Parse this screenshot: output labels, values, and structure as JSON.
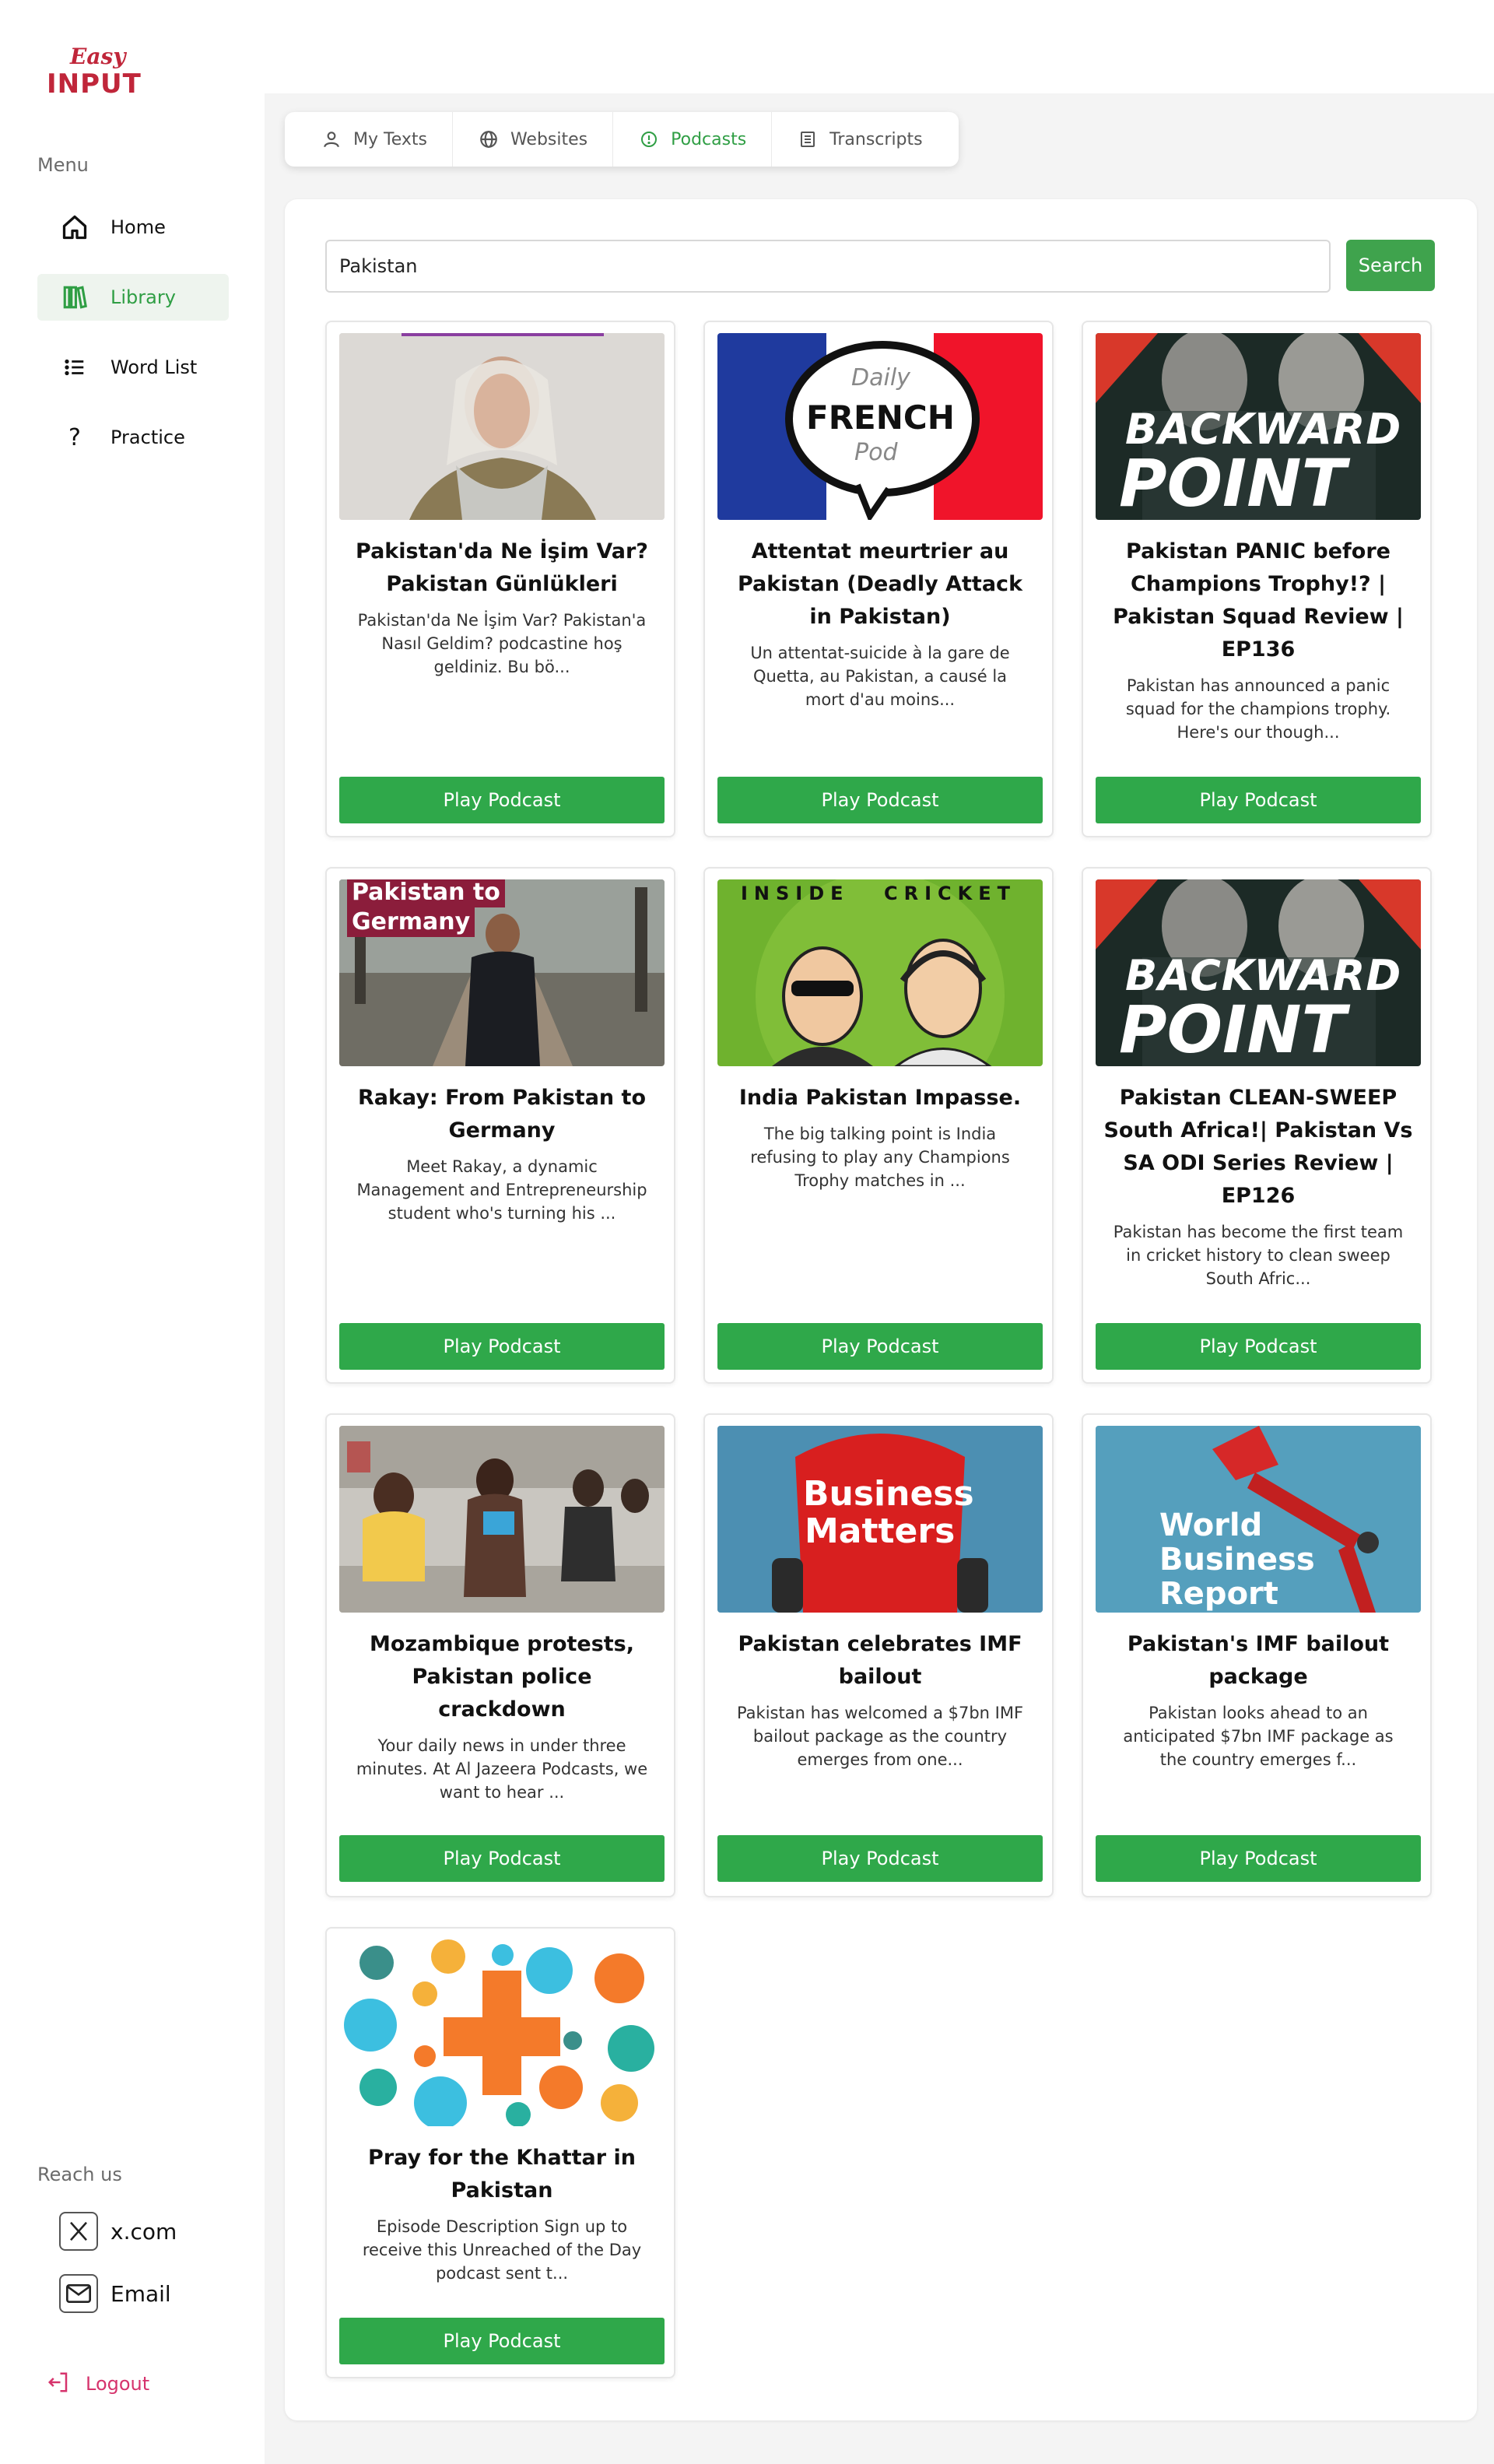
{
  "brand": {
    "logo_top": "Easy",
    "logo_bottom": "INPUT",
    "accent": "#c0263a",
    "green": "#2fa84a"
  },
  "sidebar": {
    "menu_label": "Menu",
    "items": [
      {
        "label": "Home",
        "icon": "home-icon"
      },
      {
        "label": "Library",
        "icon": "library-icon",
        "active": true
      },
      {
        "label": "Word List",
        "icon": "list-icon"
      },
      {
        "label": "Practice",
        "icon": "question-icon"
      }
    ],
    "reach_label": "Reach us",
    "contacts": [
      {
        "label": "x.com",
        "icon": "x-icon"
      },
      {
        "label": "Email",
        "icon": "mail-icon"
      }
    ],
    "logout_label": "Logout"
  },
  "tabs": [
    {
      "label": "My Texts",
      "icon": "user-icon"
    },
    {
      "label": "Websites",
      "icon": "globe-icon"
    },
    {
      "label": "Podcasts",
      "icon": "info-circle-icon",
      "active": true
    },
    {
      "label": "Transcripts",
      "icon": "document-icon"
    }
  ],
  "search": {
    "value": "Pakistan",
    "button_label": "Search"
  },
  "play_label": "Play Podcast",
  "podcasts": [
    {
      "title": "Pakistan'da Ne İşim Var? Pakistan Günlükleri",
      "desc": "Pakistan'da Ne İşim Var? Pakistan'a Nasıl Geldim? podcastine hoş geldiniz. Bu bö...",
      "thumb": "portrait"
    },
    {
      "title": "Attentat meurtrier au Pakistan (Deadly Attack in Pakistan)",
      "desc": "Un attentat-suicide à la gare de Quetta, au Pakistan, a causé la mort d'au moins...",
      "thumb": "french",
      "thumb_text": [
        "Daily",
        "FRENCH",
        "Pod"
      ]
    },
    {
      "title": "Pakistan PANIC before Champions Trophy!? | Pakistan Squad Review | EP136",
      "desc": "Pakistan has announced a panic squad for the champions trophy. Here's our though...",
      "thumb": "backward",
      "thumb_text": [
        "BACKWARD",
        "POINT"
      ]
    },
    {
      "title": "Rakay: From Pakistan to Germany",
      "desc": "Meet Rakay, a dynamic Management and Entrepreneurship student who's turning his ...",
      "thumb": "park",
      "thumb_text": [
        "Pakistan to",
        "Germany"
      ]
    },
    {
      "title": "India Pakistan Impasse.",
      "desc": "The big talking point is India refusing to play any Champions Trophy matches in ...",
      "thumb": "cricket",
      "thumb_text": [
        "INSIDE",
        "CRICKET"
      ]
    },
    {
      "title": "Pakistan CLEAN-SWEEP South Africa!| Pakistan Vs SA ODI Series Review | EP126",
      "desc": "Pakistan has become the first team in cricket history to clean sweep South Afric...",
      "thumb": "backward",
      "thumb_text": [
        "BACKWARD",
        "POINT"
      ]
    },
    {
      "title": "Mozambique protests, Pakistan police crackdown",
      "desc": "Your daily news in under three minutes. At Al Jazeera Podcasts, we want to hear ...",
      "thumb": "protest"
    },
    {
      "title": "Pakistan celebrates IMF bailout",
      "desc": "Pakistan has welcomed a $7bn IMF bailout package as the country emerges from one...",
      "thumb": "business",
      "thumb_text": [
        "Business",
        "Matters"
      ]
    },
    {
      "title": "Pakistan's IMF bailout package",
      "desc": "Pakistan looks ahead to an anticipated $7bn IMF package as the country emerges f...",
      "thumb": "wbr",
      "thumb_text": [
        "World",
        "Business",
        "Report"
      ]
    },
    {
      "title": "Pray for the Khattar in Pakistan",
      "desc": "Episode Description Sign up to receive this Unreached of the Day podcast sent t...",
      "thumb": "dots"
    }
  ]
}
